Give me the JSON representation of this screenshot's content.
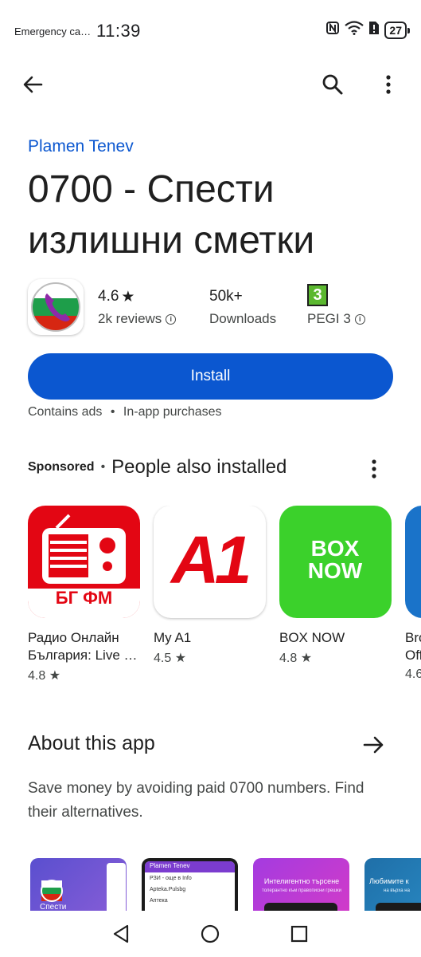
{
  "status_bar": {
    "carrier": "Emergency ca…",
    "time": "11:39",
    "battery": "27"
  },
  "app": {
    "developer": "Plamen Tenev",
    "title": "0700 - Спести излишни сметки",
    "rating": "4.6",
    "rating_star": "★",
    "reviews": "2k reviews",
    "downloads_value": "50k+",
    "downloads_label": "Downloads",
    "pegi_value": "3",
    "pegi_label": "PEGI 3",
    "install_label": "Install",
    "ads_note": "Contains ads",
    "iap_note": "In-app purchases"
  },
  "sponsored": {
    "label": "Sponsored",
    "separator": "•",
    "heading": "People also installed",
    "apps": [
      {
        "name": "Радио Онлайн",
        "name2": "България: Live …",
        "rating": "4.8",
        "icon_text": "БГ ФМ"
      },
      {
        "name": "My A1",
        "name2": "",
        "rating": "4.5",
        "icon_text": "A1"
      },
      {
        "name": "BOX NOW",
        "name2": "",
        "rating": "4.8",
        "icon_text": "BOX NOW"
      },
      {
        "name": "Bro",
        "name2": "Off",
        "rating": "4.6",
        "icon_text": ""
      }
    ]
  },
  "about": {
    "heading": "About this app",
    "description": "Save money by avoiding paid 0700 numbers. Find their alternatives."
  },
  "screenshots": [
    {
      "caption": "Спести",
      "color": "#7b5bd6"
    },
    {
      "caption": "Plamen Tenev",
      "color": "#1b1b1b",
      "lines": [
        "РЗИ - още в Info",
        "Apteka.Pulsbg",
        "Аптека"
      ]
    },
    {
      "caption": "Интелигентно търсене",
      "sub": "толерантно към правописни грешки",
      "color": "#c33bd1"
    },
    {
      "caption": "Любимите к",
      "sub": "на върха на",
      "color": "#1f6fa8"
    }
  ],
  "colors": {
    "accent": "#0b57d0",
    "a1_red": "#e30613",
    "boxnow_green": "#3bd12b",
    "radio_red": "#e30613"
  }
}
